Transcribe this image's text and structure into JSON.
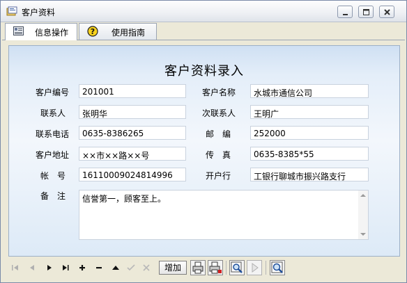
{
  "window": {
    "title": "客户资料"
  },
  "tabs": [
    {
      "label": "信息操作",
      "icon": "info-card-icon",
      "active": true
    },
    {
      "label": "使用指南",
      "icon": "help-icon",
      "active": false
    }
  ],
  "form": {
    "title": "客户资料录入",
    "fields": {
      "customer_id": {
        "label": "客户编号",
        "value": "201001"
      },
      "customer_name": {
        "label": "客户名称",
        "value": "水城市通信公司"
      },
      "contact": {
        "label": "联系人",
        "value": "张明华"
      },
      "secondary_contact": {
        "label": "次联系人",
        "value": "王明广"
      },
      "phone": {
        "label": "联系电话",
        "value": "0635-8386265"
      },
      "postcode": {
        "label": "邮　编",
        "value": "252000"
      },
      "address": {
        "label": "客户地址",
        "value": "××市××路××号"
      },
      "fax": {
        "label": "传　真",
        "value": "0635-8385*55"
      },
      "account": {
        "label": "帐　号",
        "value": "16110009024814996"
      },
      "bank": {
        "label": "开户行",
        "value": "工银行聊城市振兴路支行"
      },
      "remarks": {
        "label": "备　注",
        "value": "信誉第一，顾客至上。"
      }
    }
  },
  "toolbar": {
    "add_label": "增加",
    "buttons": [
      "first-record-icon",
      "prev-record-icon",
      "next-record-icon",
      "last-record-icon",
      "plus-icon",
      "minus-icon",
      "up-triangle-icon",
      "check-icon",
      "x-icon",
      "print-icon",
      "print-preview-icon",
      "search-icon",
      "play-icon",
      "zoom-icon"
    ]
  }
}
